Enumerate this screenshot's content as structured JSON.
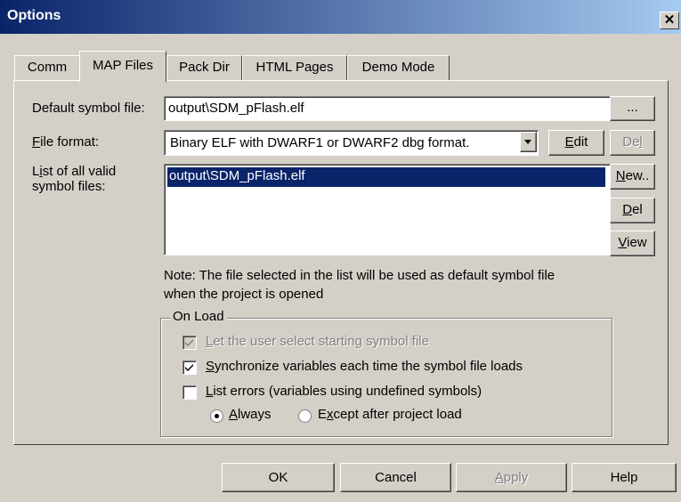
{
  "window": {
    "title": "Options"
  },
  "tabs": [
    {
      "label": "Comm"
    },
    {
      "label": "MAP Files"
    },
    {
      "label": "Pack Dir"
    },
    {
      "label": "HTML Pages"
    },
    {
      "label": "Demo Mode"
    }
  ],
  "map_files": {
    "default_symbol_label": "Default symbol file:",
    "default_symbol_value": "output\\SDM_pFlash.elf",
    "browse_label": "...",
    "file_format_label_u": "F",
    "file_format_label_rest": "ile format:",
    "file_format_value": "Binary ELF with DWARF1 or DWARF2 dbg format.",
    "edit_u": "E",
    "edit_rest": "dit",
    "del_top_pre": "De",
    "del_top_u": "l",
    "list_label_line1_pre": "L",
    "list_label_line1_u": "i",
    "list_label_line1_rest": "st of all valid",
    "list_label_line2": "symbol files:",
    "symbol_files": [
      "output\\SDM_pFlash.elf"
    ],
    "new_u": "N",
    "new_rest": "ew..",
    "del_u": "D",
    "del_rest": "el",
    "view_u": "V",
    "view_rest": "iew",
    "note_line1": "Note: The file selected in the list will be used as default symbol file",
    "note_line2": "when the project is opened"
  },
  "on_load": {
    "group_label": "On Load",
    "let_user_u": "L",
    "let_user_rest": "et the user select starting symbol file",
    "let_user_checked": true,
    "sync_u": "S",
    "sync_rest": "ynchronize variables each time the symbol file loads",
    "sync_checked": true,
    "list_errors_u": "L",
    "list_errors_rest": "ist errors (variables using undefined symbols)",
    "list_errors_checked": false,
    "always_u": "A",
    "always_rest": "lways",
    "always_selected": true,
    "except_pre": "E",
    "except_u": "x",
    "except_rest": "cept after project load",
    "except_selected": false
  },
  "buttons": {
    "ok": "OK",
    "cancel": "Cancel",
    "apply_u": "A",
    "apply_rest": "pply",
    "help": "Help"
  }
}
